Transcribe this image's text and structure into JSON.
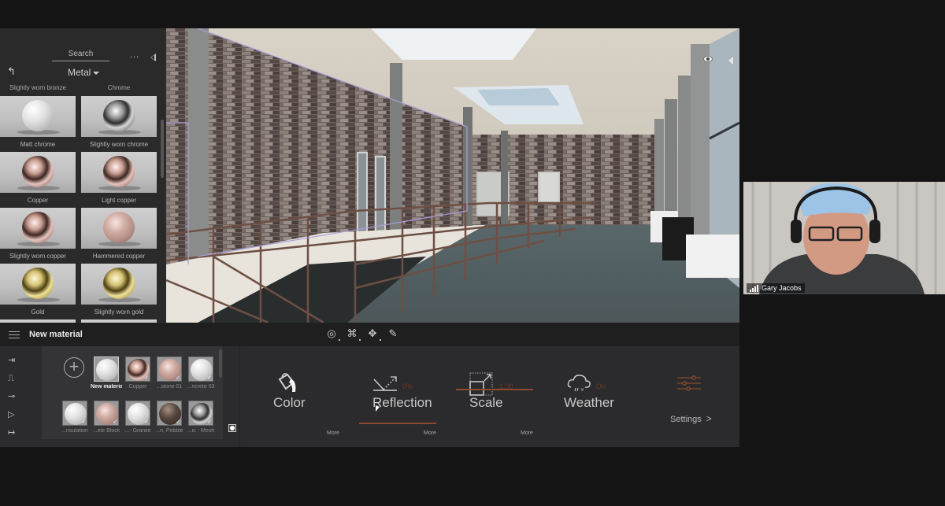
{
  "library": {
    "search_label": "Search",
    "more_label": "...",
    "category": "Metal",
    "back_icon": "back-arrow-icon",
    "collapse_icon": "collapse-left-icon",
    "top_labels": [
      "Slightly worn bronze",
      "Chrome"
    ],
    "materials": [
      {
        "name": "Matt chrome",
        "finish": "matte"
      },
      {
        "name": "Slightly worn chrome",
        "finish": "chrome"
      },
      {
        "name": "Copper",
        "finish": "copper"
      },
      {
        "name": "Light copper",
        "finish": "copper"
      },
      {
        "name": "Slightly worn copper",
        "finish": "copper"
      },
      {
        "name": "Hammered copper",
        "finish": "hammered"
      },
      {
        "name": "Gold",
        "finish": "gold"
      },
      {
        "name": "Slightly worn gold",
        "finish": "gold"
      }
    ]
  },
  "viewport": {
    "visibility_icon": "eye-icon",
    "panel_icon": "collapse-right-icon",
    "tools": [
      {
        "name": "orbit-tool",
        "icon": "orbit-icon",
        "glyph": "◎"
      },
      {
        "name": "pan-tool",
        "icon": "pan-icon",
        "glyph": "⌘"
      },
      {
        "name": "move-tool",
        "icon": "move-icon",
        "glyph": "✥"
      },
      {
        "name": "eyedropper-tool",
        "icon": "eyedropper-icon",
        "glyph": "✎"
      }
    ]
  },
  "editor": {
    "title": "New material",
    "menu_icon": "hamburger-icon",
    "side_icons": [
      {
        "name": "import-icon",
        "glyph": "⇥"
      },
      {
        "name": "texture-icon",
        "glyph": "⎍"
      },
      {
        "name": "slider-icon",
        "glyph": "⊸"
      },
      {
        "name": "video-icon",
        "glyph": "▷"
      },
      {
        "name": "export-icon",
        "glyph": "↦"
      }
    ],
    "add_label": "+",
    "materials_row1": [
      {
        "label": "New material",
        "finish": "matte",
        "selected": true
      },
      {
        "label": "Copper",
        "finish": "copper",
        "selected": false
      },
      {
        "label": "...stone 01",
        "finish": "hammered",
        "selected": false
      },
      {
        "label": "...ncrete 03",
        "finish": "matte",
        "selected": false
      }
    ],
    "materials_row2": [
      {
        "label": "...nsulation",
        "finish": "matte"
      },
      {
        "label": "...ete Block",
        "finish": "hammered"
      },
      {
        "label": "...- Granite",
        "finish": "matte"
      },
      {
        "label": "...n, Pebble",
        "finish": "dark"
      },
      {
        "label": "...ic - Mesh",
        "finish": "chrome"
      }
    ],
    "properties": {
      "color": {
        "label": "Color",
        "value": "...",
        "more": "More"
      },
      "reflection": {
        "label": "Reflection",
        "value": "0%",
        "more": "More"
      },
      "scale": {
        "label": "Scale",
        "value": "1.00",
        "more": "More"
      },
      "weather": {
        "label": "Weather",
        "value": "On"
      }
    },
    "settings_label": "Settings",
    "settings_chevron": ">",
    "accent_color": "#8a4a2c"
  },
  "participant": {
    "name": "Gary Jacobs"
  }
}
